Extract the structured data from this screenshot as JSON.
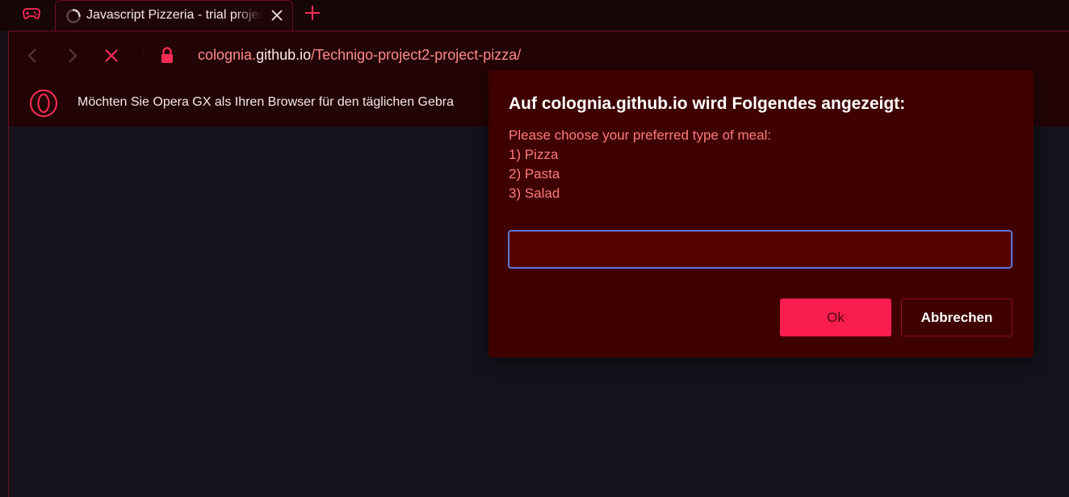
{
  "tab": {
    "title": "Javascript Pizzeria - trial project",
    "loading": true
  },
  "address_bar": {
    "host": "cologni a.github.io",
    "host_prefix": "colognia.",
    "host_main": "github.io",
    "path": "/Technigo-project2-project-pizza/",
    "secure": true
  },
  "infobar": {
    "text": "Möchten Sie Opera GX als Ihren Browser für den täglichen Gebra"
  },
  "dialog": {
    "title": "Auf colognia.github.io wird Folgendes angezeigt:",
    "message_lines": [
      "Please choose your preferred type of meal:",
      "1) Pizza",
      "2) Pasta",
      "3) Salad"
    ],
    "input_value": "",
    "ok_label": "Ok",
    "cancel_label": "Abbrechen"
  },
  "colors": {
    "accent": "#fa1e4e",
    "dialog_bg": "#3f0000",
    "input_bg": "#560000",
    "focus_ring": "#5d78d6",
    "message_text": "#ff7b7b",
    "chrome_bg": "#230406"
  },
  "icons": {
    "gx_corner": "gamepad-icon",
    "tab_loading": "loading-spinner-icon",
    "tab_close": "close-icon",
    "new_tab": "plus-icon",
    "back": "chevron-left-icon",
    "forward": "chevron-right-icon",
    "stop": "stop-x-icon",
    "lock": "lock-icon",
    "opera": "opera-logo-icon"
  }
}
